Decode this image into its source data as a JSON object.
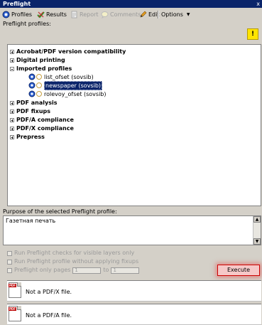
{
  "window": {
    "title": "Preflight",
    "close_glyph": "x"
  },
  "toolbar": {
    "profiles": "Profiles",
    "results": "Results",
    "report": "Report",
    "comments": "Comments",
    "edit": "Edit",
    "options": "Options",
    "options_arrow": "▼"
  },
  "profiles_label": "Preflight profiles:",
  "warning_glyph": "!",
  "tree": {
    "items": [
      {
        "label": "Acrobat/PDF version compatibility"
      },
      {
        "label": "Digital printing"
      },
      {
        "label": "Imported profiles"
      },
      {
        "label": "list_ofset (sovsib)"
      },
      {
        "label": "newspaper (sovsib)"
      },
      {
        "label": "rolevoy_ofset (sovsib)"
      },
      {
        "label": "PDF analysis"
      },
      {
        "label": "PDF fixups"
      },
      {
        "label": "PDF/A compliance"
      },
      {
        "label": "PDF/X compliance"
      },
      {
        "label": "Prepress"
      }
    ]
  },
  "purpose": {
    "label": "Purpose of the selected Preflight profile:",
    "text": "Газетная печать"
  },
  "options": {
    "visible_layers": "Run Preflight checks for visible layers only",
    "without_fixups": "Run Preflight profile without applying fixups",
    "only_pages": "Preflight only pages",
    "page_from": "1",
    "to": "to",
    "page_to": "1"
  },
  "execute_label": "Execute",
  "results": [
    {
      "text": "Not a PDF/X file.",
      "icon_tag": "PDF"
    },
    {
      "text": "Not a PDF/A file.",
      "icon_tag": "PDF"
    }
  ]
}
